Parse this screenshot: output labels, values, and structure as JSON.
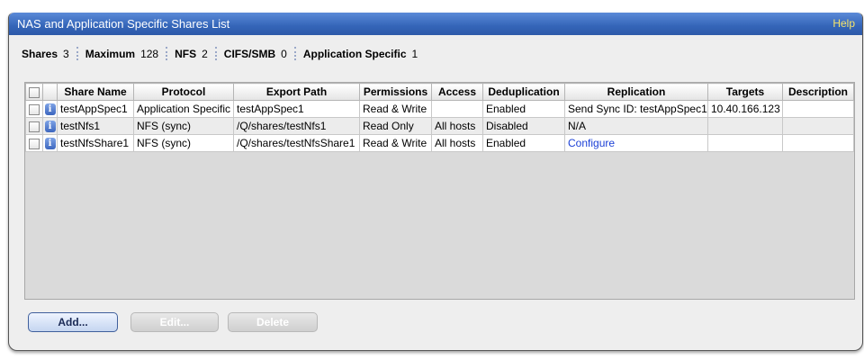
{
  "header": {
    "title": "NAS and Application Specific Shares List",
    "help_label": "Help"
  },
  "summary": [
    {
      "label": "Shares",
      "value": "3"
    },
    {
      "label": "Maximum",
      "value": "128"
    },
    {
      "label": "NFS",
      "value": "2"
    },
    {
      "label": "CIFS/SMB",
      "value": "0"
    },
    {
      "label": "Application Specific",
      "value": "1"
    }
  ],
  "table": {
    "columns": [
      "Share Name",
      "Protocol",
      "Export Path",
      "Permissions",
      "Access",
      "Deduplication",
      "Replication",
      "Targets",
      "Description"
    ],
    "rows": [
      {
        "share_name": "testAppSpec1",
        "protocol": "Application Specific",
        "export_path": "testAppSpec1",
        "permissions": "Read & Write",
        "access": "",
        "deduplication": "Enabled",
        "replication": "Send Sync ID: testAppSpec1",
        "targets": "10.40.166.123",
        "description": ""
      },
      {
        "share_name": "testNfs1",
        "protocol": "NFS  (sync)",
        "export_path": "/Q/shares/testNfs1",
        "permissions": "Read Only",
        "access": "All hosts",
        "deduplication": "Disabled",
        "replication": "N/A",
        "targets": "",
        "description": ""
      },
      {
        "share_name": "testNfsShare1",
        "protocol": "NFS  (sync)",
        "export_path": "/Q/shares/testNfsShare1",
        "permissions": "Read & Write",
        "access": "All hosts",
        "deduplication": "Enabled",
        "replication": "Configure",
        "targets": "",
        "description": ""
      }
    ]
  },
  "buttons": {
    "add": "Add...",
    "edit": "Edit...",
    "delete": "Delete"
  },
  "icons": {
    "info": "i"
  },
  "colors": {
    "title_bar": "#3465b8",
    "help_link": "#f6e46a",
    "link": "#1a3fd6"
  }
}
